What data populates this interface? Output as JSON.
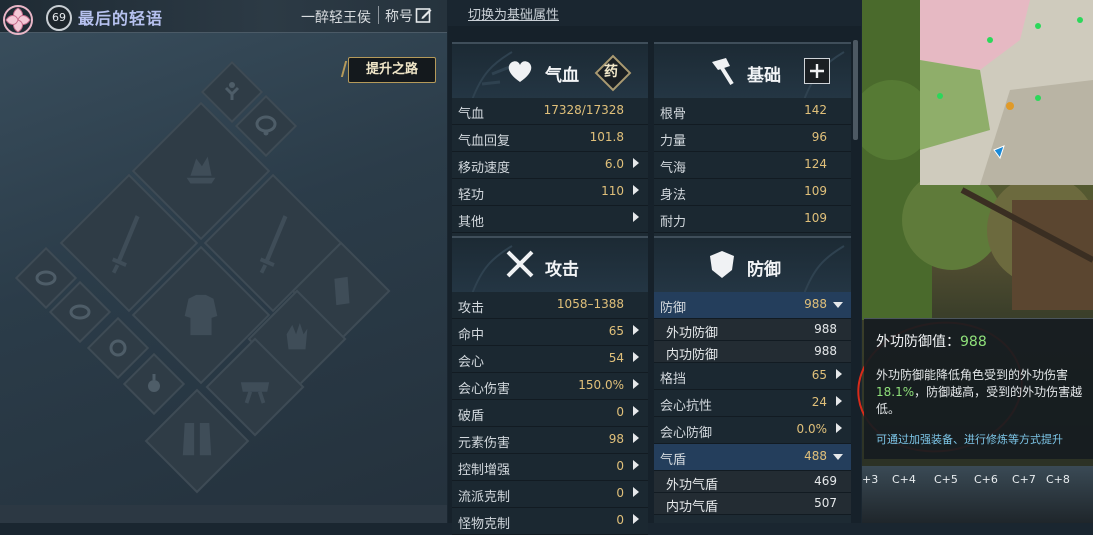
{
  "character": {
    "level": "69",
    "name": "最后的轻语",
    "title": "一醉轻王侯",
    "title_button": "称号",
    "upgrade_button": "提升之路"
  },
  "switch_link": "切换为基础属性",
  "qixue_panel": {
    "title": "气血",
    "badge": "药",
    "rows": [
      {
        "label": "气血",
        "value": "17328/17328"
      },
      {
        "label": "气血回复",
        "value": "101.8"
      },
      {
        "label": "移动速度",
        "value": "6.0"
      },
      {
        "label": "轻功",
        "value": "110"
      },
      {
        "label": "其他",
        "value": ""
      }
    ]
  },
  "jichu_panel": {
    "title": "基础",
    "rows": [
      {
        "label": "根骨",
        "value": "142"
      },
      {
        "label": "力量",
        "value": "96"
      },
      {
        "label": "气海",
        "value": "124"
      },
      {
        "label": "身法",
        "value": "109"
      },
      {
        "label": "耐力",
        "value": "109"
      }
    ]
  },
  "gongji_panel": {
    "title": "攻击",
    "rows": [
      {
        "label": "攻击",
        "value": "1058–1388"
      },
      {
        "label": "命中",
        "value": "65"
      },
      {
        "label": "会心",
        "value": "54"
      },
      {
        "label": "会心伤害",
        "value": "150.0%"
      },
      {
        "label": "破盾",
        "value": "0"
      },
      {
        "label": "元素伤害",
        "value": "98"
      },
      {
        "label": "控制增强",
        "value": "0"
      },
      {
        "label": "流派克制",
        "value": "0"
      },
      {
        "label": "怪物克制",
        "value": "0"
      }
    ]
  },
  "fangyu_panel": {
    "title": "防御",
    "rows": [
      {
        "label": "防御",
        "value": "988",
        "type": "sel"
      },
      {
        "label": "外功防御",
        "value": "988",
        "type": "sub"
      },
      {
        "label": "内功防御",
        "value": "988",
        "type": "sub"
      },
      {
        "label": "格挡",
        "value": "65",
        "type": "row"
      },
      {
        "label": "会心抗性",
        "value": "24",
        "type": "row"
      },
      {
        "label": "会心防御",
        "value": "0.0%",
        "type": "row"
      },
      {
        "label": "气盾",
        "value": "488",
        "type": "sel"
      },
      {
        "label": "外功气盾",
        "value": "469",
        "type": "sub"
      },
      {
        "label": "内功气盾",
        "value": "507",
        "type": "sub"
      }
    ]
  },
  "tooltip": {
    "title": "外功防御值：",
    "value": "988",
    "desc_pre": "外功防御能降低角色受到的外功伤害",
    "percent": "18.1%",
    "desc_post": "，防御越高，受到的外功伤害越低。",
    "hint": "可通过加强装备、进行修炼等方式提升"
  },
  "hotbar": [
    "+3",
    "C+4",
    "C+5",
    "C+6",
    "C+7",
    "C+8"
  ],
  "colors": {
    "accent_value": "#e0c07a",
    "highlight_green": "#8fe07a",
    "selected_row": "#243e5c"
  }
}
